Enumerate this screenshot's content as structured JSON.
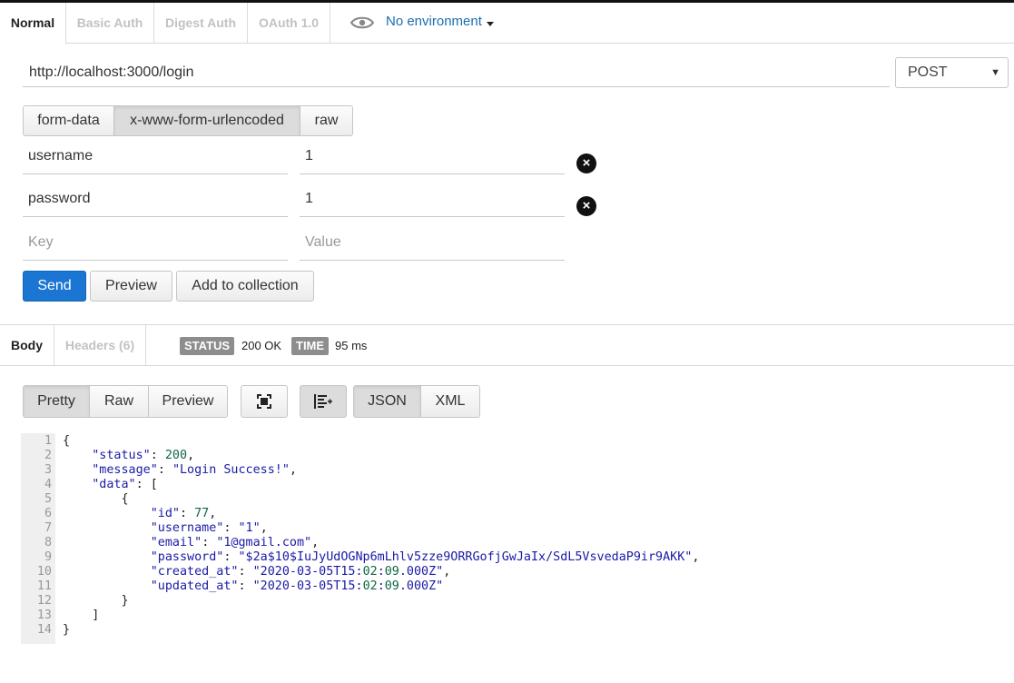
{
  "auth_tabs": [
    "Normal",
    "Basic Auth",
    "Digest Auth",
    "OAuth 1.0"
  ],
  "environment": {
    "label": "No environment",
    "icon": "eye-icon"
  },
  "request": {
    "url": "http://localhost:3000/login",
    "method": "POST"
  },
  "body_modes": [
    "form-data",
    "x-www-form-urlencoded",
    "raw"
  ],
  "body_mode_selected": "x-www-form-urlencoded",
  "params": [
    {
      "key": "username",
      "value": "1"
    },
    {
      "key": "password",
      "value": "1"
    }
  ],
  "new_param": {
    "key_placeholder": "Key",
    "value_placeholder": "Value"
  },
  "actions": {
    "send": "Send",
    "preview": "Preview",
    "add": "Add to collection"
  },
  "response": {
    "tabs": [
      "Body",
      "Headers (6)"
    ],
    "status_label": "STATUS",
    "status_value": "200 OK",
    "time_label": "TIME",
    "time_value": "95 ms",
    "view_modes": [
      "Pretty",
      "Raw",
      "Preview"
    ],
    "formats": [
      "JSON",
      "XML"
    ],
    "line_numbers": [
      "1",
      "2",
      "3",
      "4",
      "5",
      "6",
      "7",
      "8",
      "9",
      "10",
      "11",
      "12",
      "13",
      "14"
    ],
    "lines": [
      "{",
      "    \"status\": 200,",
      "    \"message\": \"Login Success!\",",
      "    \"data\": [",
      "        {",
      "            \"id\": 77,",
      "            \"username\": \"1\",",
      "            \"email\": \"1@gmail.com\",",
      "            \"password\": \"$2a$10$IuJyUdOGNp6mLhlv5zze9ORRGofjGwJaIx/SdL5VsvedaP9ir9AKK\",",
      "            \"created_at\": \"2020-03-05T15:02:09.000Z\",",
      "            \"updated_at\": \"2020-03-05T15:02:09.000Z\"",
      "        }",
      "    ]",
      "}"
    ]
  }
}
